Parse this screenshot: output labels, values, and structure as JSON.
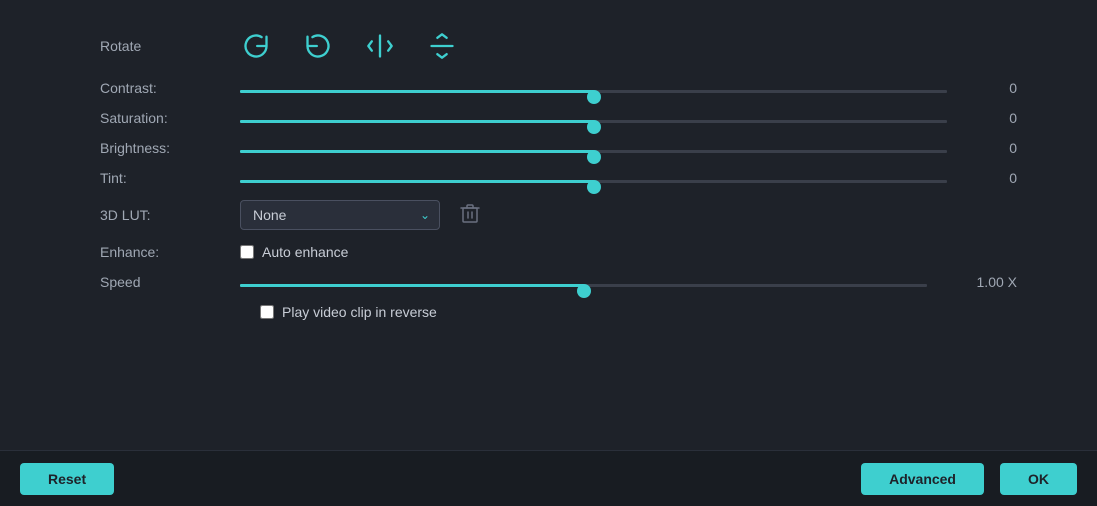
{
  "rotate": {
    "label": "Rotate",
    "icons": [
      {
        "name": "rotate-right-icon",
        "symbol": "↻"
      },
      {
        "name": "rotate-left-icon",
        "symbol": "↺"
      },
      {
        "name": "flip-horizontal-icon",
        "symbol": "⇔"
      },
      {
        "name": "flip-vertical-icon",
        "symbol": "⇕"
      }
    ]
  },
  "sliders": [
    {
      "id": "contrast",
      "label": "Contrast:",
      "value": 0,
      "min": -100,
      "max": 100
    },
    {
      "id": "saturation",
      "label": "Saturation:",
      "value": 0,
      "min": -100,
      "max": 100
    },
    {
      "id": "brightness",
      "label": "Brightness:",
      "value": 0,
      "min": -100,
      "max": 100
    },
    {
      "id": "tint",
      "label": "Tint:",
      "value": 0,
      "min": -100,
      "max": 100
    }
  ],
  "lut": {
    "label": "3D LUT:",
    "value": "None",
    "options": [
      "None"
    ]
  },
  "enhance": {
    "label": "Enhance:",
    "checkbox_label": "Auto enhance",
    "checked": false
  },
  "speed": {
    "label": "Speed",
    "value": 0,
    "display_value": "1.00 X",
    "min": -100,
    "max": 100
  },
  "reverse": {
    "label": "Play video clip in reverse",
    "checked": false
  },
  "buttons": {
    "reset": "Reset",
    "advanced": "Advanced",
    "ok": "OK"
  }
}
